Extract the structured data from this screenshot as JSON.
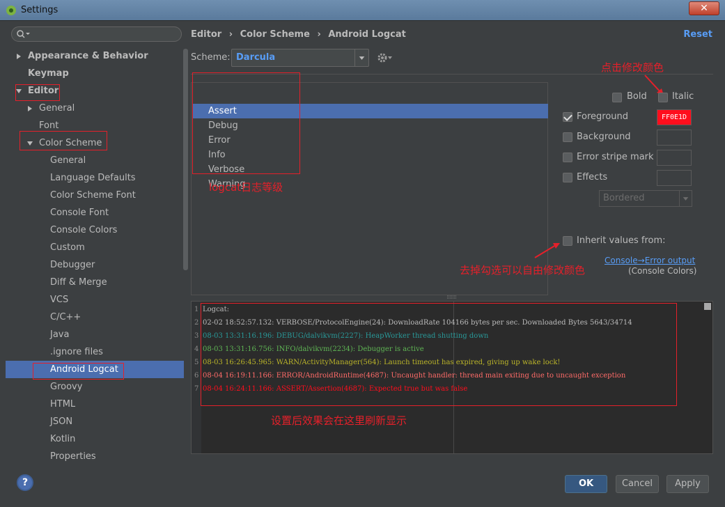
{
  "window": {
    "title": "Settings",
    "close_glyph": "✕",
    "app_icon": "android-studio-icon"
  },
  "search": {
    "placeholder": "",
    "icon": "search-icon"
  },
  "sidebar": {
    "items": [
      {
        "label": "Appearance & Behavior"
      },
      {
        "label": "Keymap"
      },
      {
        "label": "Editor"
      },
      {
        "label": "General"
      },
      {
        "label": "Font"
      },
      {
        "label": "Color Scheme"
      },
      {
        "label": "General"
      },
      {
        "label": "Language Defaults"
      },
      {
        "label": "Color Scheme Font"
      },
      {
        "label": "Console Font"
      },
      {
        "label": "Console Colors"
      },
      {
        "label": "Custom"
      },
      {
        "label": "Debugger"
      },
      {
        "label": "Diff & Merge"
      },
      {
        "label": "VCS"
      },
      {
        "label": "C/C++"
      },
      {
        "label": "Java"
      },
      {
        "label": ".ignore files"
      },
      {
        "label": "Android Logcat"
      },
      {
        "label": "Groovy"
      },
      {
        "label": "HTML"
      },
      {
        "label": "JSON"
      },
      {
        "label": "Kotlin"
      },
      {
        "label": "Properties"
      }
    ],
    "selected": "Android Logcat"
  },
  "breadcrumb": [
    "Editor",
    "›",
    "Color Scheme",
    "›",
    "Android Logcat"
  ],
  "reset_label": "Reset",
  "scheme": {
    "label": "Scheme:",
    "value": "Darcula",
    "gear_icon": "gear-icon"
  },
  "levels": {
    "items": [
      "Assert",
      "Debug",
      "Error",
      "Info",
      "Verbose",
      "Warning"
    ],
    "selected": "Assert"
  },
  "attributes": {
    "bold": {
      "label": "Bold",
      "checked": false
    },
    "italic": {
      "label": "Italic",
      "checked": false
    },
    "foreground": {
      "label": "Foreground",
      "checked": true,
      "value": "FF0E1D"
    },
    "background": {
      "label": "Background",
      "checked": false
    },
    "error_stripe": {
      "label": "Error stripe mark",
      "checked": false
    },
    "effects": {
      "label": "Effects",
      "checked": false,
      "style": "Bordered"
    },
    "inherit": {
      "label": "Inherit values from:",
      "checked": false
    },
    "inherit_link": "Console→Error output",
    "inherit_hint": "(Console Colors)"
  },
  "annotations": {
    "click_change_color": "点击修改颜色",
    "logcat_levels": "logcat日志等级",
    "uncheck_hint": "去掉勾选可以自由修改颜色",
    "preview_hint": "设置后效果会在这里刷新显示"
  },
  "preview": {
    "lines": [
      {
        "ln": "1",
        "text": "Logcat:",
        "color": "#bbbbbb"
      },
      {
        "ln": "2",
        "text": "02-02 18:52:57.132: VERBOSE/ProtocolEngine(24): DownloadRate 104166 bytes per sec. Downloaded Bytes 5643/34714",
        "color": "#bbbbbb"
      },
      {
        "ln": "3",
        "text": "08-03 13:31:16.196: DEBUG/dalvikvm(2227): HeapWorker thread shutting down",
        "color": "#299999"
      },
      {
        "ln": "4",
        "text": "08-03 13:31:16.756: INFO/dalvikvm(2234): Debugger is active",
        "color": "#5fb554"
      },
      {
        "ln": "5",
        "text": "08-03 16:26:45.965: WARN/ActivityManager(564): Launch timeout has expired, giving up wake lock!",
        "color": "#bbb529"
      },
      {
        "ln": "6",
        "text": "08-04 16:19:11.166: ERROR/AndroidRuntime(4687): Uncaught handler: thread main exiting due to uncaught exception",
        "color": "#ff6b68"
      },
      {
        "ln": "7",
        "text": "08-04 16:24:11.166: ASSERT/Assertion(4687): Expected true but was false",
        "color": "#ff0e1d"
      }
    ]
  },
  "buttons": {
    "help": "?",
    "ok": "OK",
    "cancel": "Cancel",
    "apply": "Apply"
  },
  "colors": {
    "accent": "#4b6eaf",
    "link": "#589df6",
    "annotation": "#e5202a",
    "foreground_swatch": "#ff0e1d"
  }
}
